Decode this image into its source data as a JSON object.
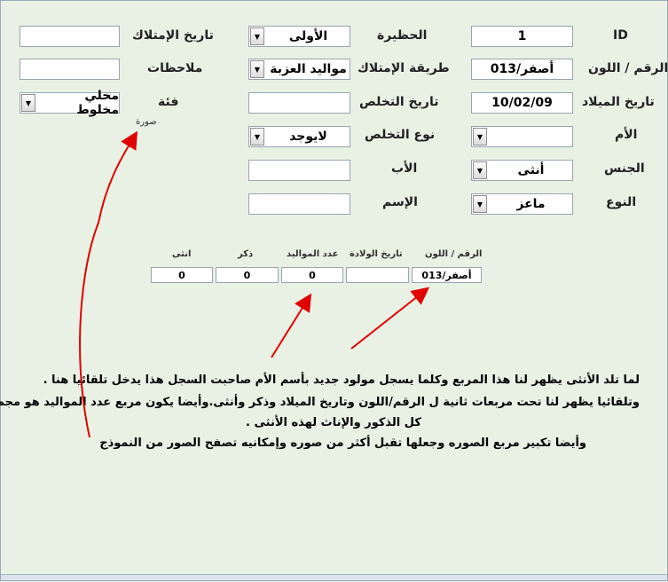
{
  "fields": {
    "id": {
      "label": "ID",
      "value": "1"
    },
    "number_color": {
      "label": "الرقم / اللون",
      "value": "أصفر/013"
    },
    "birth_date": {
      "label": "تاريخ الميلاد",
      "value": "10/02/09"
    },
    "mother": {
      "label": "الأم",
      "value": ""
    },
    "sex": {
      "label": "الجنس",
      "value": "أنثى"
    },
    "species": {
      "label": "النوع",
      "value": "ماعز"
    },
    "pen": {
      "label": "الحظيرة",
      "value": "الأولى"
    },
    "acquisition_method": {
      "label": "طريقة الإمتلاك",
      "value": "مواليد العزبة"
    },
    "disposal_date": {
      "label": "تاريخ التخلص",
      "value": ""
    },
    "disposal_type": {
      "label": "نوع التخلص",
      "value": "لايوجد"
    },
    "father": {
      "label": "الأب",
      "value": ""
    },
    "name": {
      "label": "الإسم",
      "value": ""
    },
    "acquisition_date": {
      "label": "تاريخ الإمتلاك",
      "value": ""
    },
    "notes": {
      "label": "ملاحظات",
      "value": ""
    },
    "category": {
      "label": "فئة",
      "value": "محلي مخلوط"
    },
    "photo_caption": "صورة"
  },
  "subform": {
    "headers": [
      "الرقم / اللون",
      "تاريخ الولادة",
      "عدد المواليد",
      "ذكر",
      "انثى"
    ],
    "values": [
      "أصفر/013",
      "",
      "0",
      "0",
      "0"
    ]
  },
  "notes_text": {
    "line1": "لما تلد الأنثى يظهر لنا هذا المربع وكلما يسجل مولود جديد بأسم الأم صاحبت السجل هذا يدخل تلقائيا هنا .",
    "line2": "وتلقائيا يظهر لنا تحت مربعات ثانية ل الرقم/اللون  وتاريخ الميلاد وذكر وأنثى.وأيضا يكون مربع عدد المواليد هو مجموع",
    "line3": "كل الذكور والإناث لهذه الأنثى .",
    "line4": "وأيضا تكبير مربع الصوره وجعلها تقبل أكثر من صوره وإمكانيه تصفح الصور من النموذج"
  },
  "colors": {
    "arrow": "#e00000",
    "background": "#e9f1e5"
  }
}
